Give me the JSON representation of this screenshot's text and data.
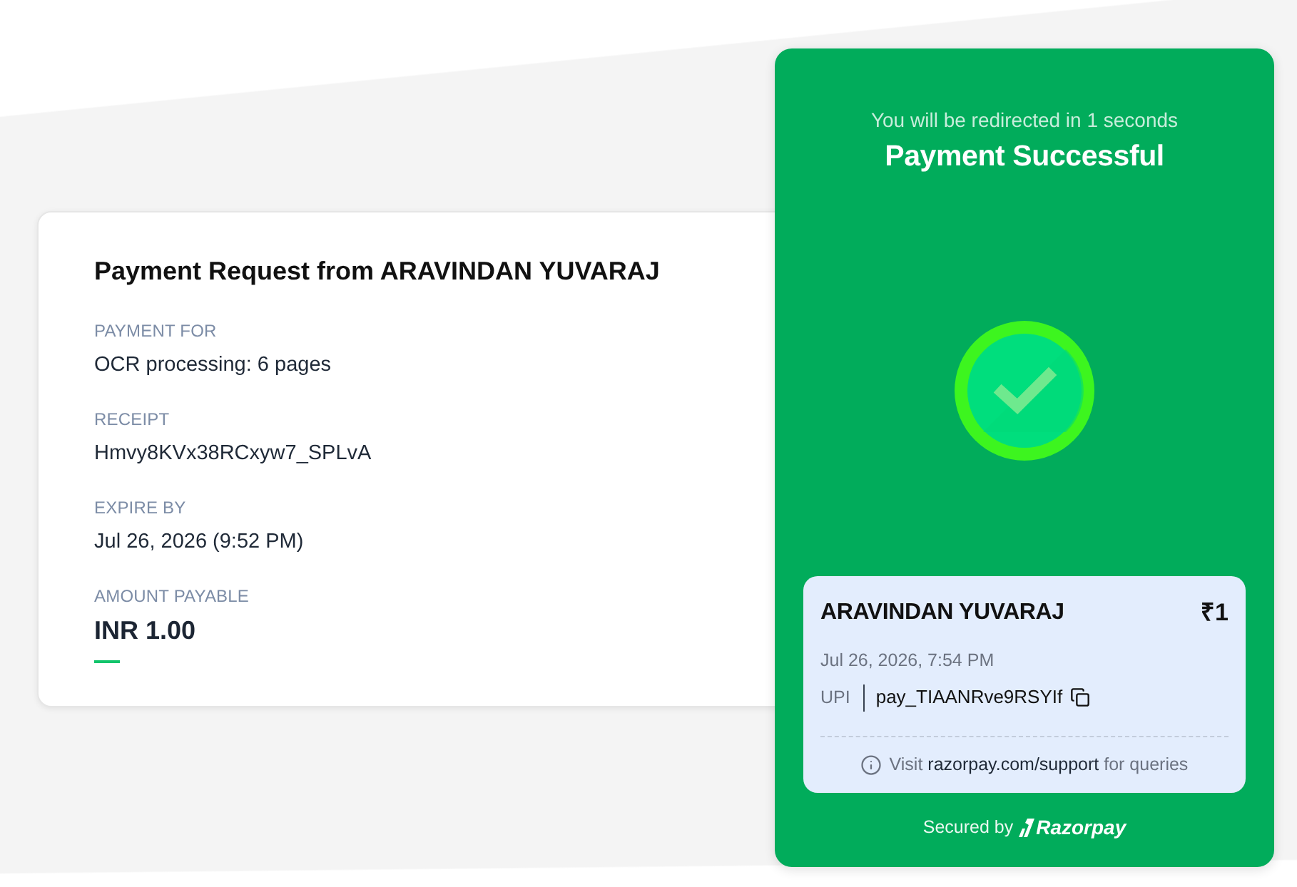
{
  "request": {
    "title": "Payment Request from ARAVINDAN YUVARAJ",
    "fields": [
      {
        "kind": "text",
        "label": "PAYMENT FOR",
        "value": "OCR processing: 6 pages"
      },
      {
        "kind": "text",
        "label": "RECEIPT",
        "value": "Hmvy8KVx38RCxyw7_SPLvA"
      },
      {
        "kind": "text",
        "label": "EXPIRE BY",
        "value": "Jul 26, 2026 (9:52 PM)"
      },
      {
        "kind": "amount",
        "label": "AMOUNT PAYABLE",
        "value": "INR 1.00"
      }
    ]
  },
  "result": {
    "kind": "success",
    "redirect_notice": "You will be redirected in 1 seconds",
    "title": "Payment Successful",
    "receipt": {
      "payee": "ARAVINDAN YUVARAJ",
      "amount": "₹1",
      "date": "Jul 26, 2026, 7:54 PM",
      "method": "UPI",
      "payment_id": "pay_TIAANRve9RSYIf",
      "support": {
        "prefix": "Visit",
        "link": "razorpay.com/support",
        "suffix": "for queries"
      }
    },
    "footer": {
      "text": "Secured by",
      "brand": "Razorpay"
    }
  }
}
